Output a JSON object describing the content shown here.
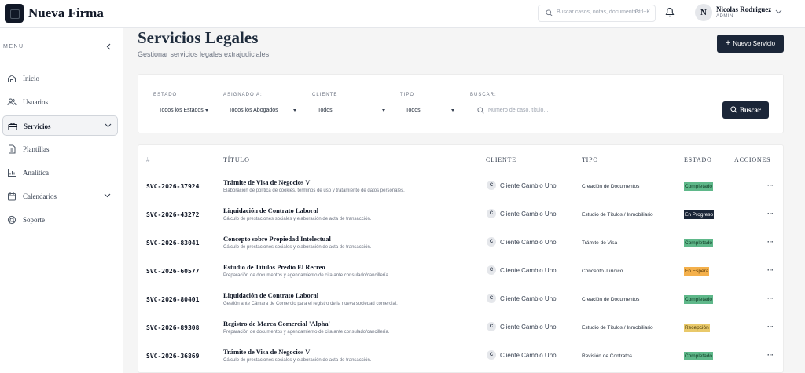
{
  "app": {
    "brand": "Nueva Firma"
  },
  "topbar": {
    "search_placeholder": "Buscar casos, notas, documentos...",
    "search_shortcut": "Ctrl+K",
    "user": {
      "initial": "N",
      "name": "Nicolas Rodriguez",
      "role": "ADMIN"
    }
  },
  "sidebar": {
    "menu_label": "MENU",
    "items": [
      {
        "label": "Inicio",
        "icon": "home-icon"
      },
      {
        "label": "Usuarios",
        "icon": "users-icon"
      },
      {
        "label": "Servicios",
        "icon": "briefcase-icon",
        "active": true
      },
      {
        "label": "Plantillas",
        "icon": "document-icon"
      },
      {
        "label": "Analítica",
        "icon": "chart-icon"
      },
      {
        "label": "Calendarios",
        "icon": "calendar-icon"
      },
      {
        "label": "Soporte",
        "icon": "support-icon"
      }
    ]
  },
  "page": {
    "title": "Servicios Legales",
    "subtitle": "Gestionar servicios legales extrajudiciales",
    "new_button": "Nuevo Servicio"
  },
  "filters": {
    "estado": {
      "label": "ESTADO",
      "value": "Todos los Estados"
    },
    "asignado": {
      "label": "ASIGNADO A:",
      "value": "Todos los Abogados"
    },
    "cliente": {
      "label": "CLIENTE",
      "value": "Todos"
    },
    "tipo": {
      "label": "TIPO",
      "value": "Todos"
    },
    "buscar": {
      "label": "BUSCAR:",
      "placeholder": "Número de caso, título..."
    },
    "search_button": "Buscar"
  },
  "table": {
    "headers": {
      "hash": "#",
      "title": "TÍTULO",
      "client": "CLIENTE",
      "type": "TIPO",
      "status": "ESTADO",
      "actions": "ACCIONES"
    },
    "status_colors": {
      "Completado": {
        "bg": "#5fb88a",
        "fg": "#0f3b25"
      },
      "En Progreso": {
        "bg": "#1b2638",
        "fg": "#ffffff"
      },
      "En Espera": {
        "bg": "#f4b04b",
        "fg": "#5a3a05"
      },
      "Recepción": {
        "bg": "#e9c96a",
        "fg": "#4a3a0a"
      }
    },
    "rows": [
      {
        "id": "SVC-2026-37924",
        "title": "Trámite de Visa de Negocios V",
        "desc": "Elaboración de política de cookies, términos de uso y tratamiento de datos personales.",
        "client_initial": "C",
        "client": "Cliente Cambio Uno",
        "type": "Creación de Documentos",
        "status": "Completado",
        "actions": "···"
      },
      {
        "id": "SVC-2026-43272",
        "title": "Liquidación de Contrato Laboral",
        "desc": "Cálculo de prestaciones sociales y elaboración de acta de transacción.",
        "client_initial": "C",
        "client": "Cliente Cambio Uno",
        "type": "Estudio de Títulos / Inmobiliario",
        "status": "En Progreso",
        "actions": "···"
      },
      {
        "id": "SVC-2026-83041",
        "title": "Concepto sobre Propiedad Intelectual",
        "desc": "Cálculo de prestaciones sociales y elaboración de acta de transacción.",
        "client_initial": "C",
        "client": "Cliente Cambio Uno",
        "type": "Trámite de Visa",
        "status": "Completado",
        "actions": "···"
      },
      {
        "id": "SVC-2026-60577",
        "title": "Estudio de Títulos Predio El Recreo",
        "desc": "Preparación de documentos y agendamiento de cita ante consulado/cancillería.",
        "client_initial": "C",
        "client": "Cliente Cambio Uno",
        "type": "Concepto Jurídico",
        "status": "En Espera",
        "actions": "···"
      },
      {
        "id": "SVC-2026-80401",
        "title": "Liquidación de Contrato Laboral",
        "desc": "Gestión ante Cámara de Comercio para el registro de la nueva sociedad comercial.",
        "client_initial": "C",
        "client": "Cliente Cambio Uno",
        "type": "Creación de Documentos",
        "status": "Completado",
        "actions": "···"
      },
      {
        "id": "SVC-2026-89308",
        "title": "Registro de Marca Comercial 'Alpha'",
        "desc": "Preparación de documentos y agendamiento de cita ante consulado/cancillería.",
        "client_initial": "C",
        "client": "Cliente Cambio Uno",
        "type": "Estudio de Títulos / Inmobiliario",
        "status": "Recepción",
        "actions": "···"
      },
      {
        "id": "SVC-2026-36869",
        "title": "Trámite de Visa de Negocios V",
        "desc": "Cálculo de prestaciones sociales y elaboración de acta de transacción.",
        "client_initial": "C",
        "client": "Cliente Cambio Uno",
        "type": "Revisión de Contratos",
        "status": "Completado",
        "actions": "···"
      }
    ]
  }
}
